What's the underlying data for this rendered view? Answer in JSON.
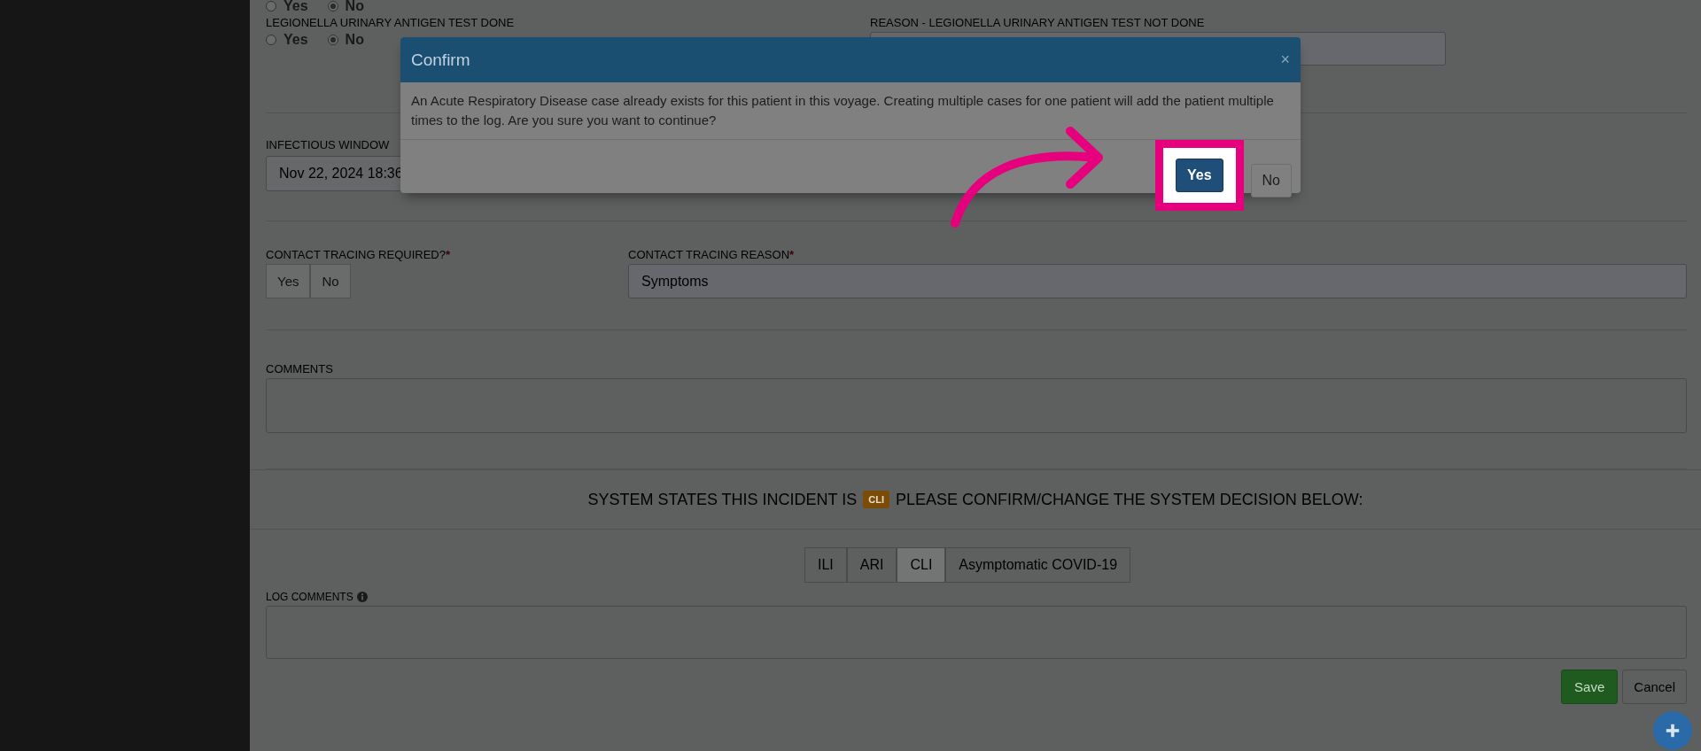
{
  "top_radio": {
    "options": [
      {
        "label": "Yes",
        "selected": false
      },
      {
        "label": "No",
        "selected": true
      }
    ]
  },
  "legionella": {
    "label": "LEGIONELLA URINARY ANTIGEN TEST DONE",
    "options": [
      {
        "label": "Yes",
        "selected": false
      },
      {
        "label": "No",
        "selected": true
      }
    ]
  },
  "legionella_reason": {
    "label": "REASON - LEGIONELLA URINARY ANTIGEN TEST NOT DONE"
  },
  "infectious_window": {
    "label": "INFECTIOUS WINDOW",
    "value": "Nov 22, 2024 18:36"
  },
  "contact_tracing_required": {
    "label": "CONTACT TRACING REQUIRED?",
    "required_mark": "*",
    "options": [
      {
        "label": "Yes",
        "selected": false
      },
      {
        "label": "No",
        "selected": false
      }
    ]
  },
  "contact_tracing_reason": {
    "label": "CONTACT TRACING REASON",
    "required_mark": "*",
    "value": "Symptoms"
  },
  "comments": {
    "label": "COMMENTS"
  },
  "system_banner": {
    "text_before": "SYSTEM STATES THIS INCIDENT IS",
    "badge": "CLI",
    "text_after": "PLEASE CONFIRM/CHANGE THE SYSTEM DECISION BELOW:"
  },
  "classification": [
    {
      "label": "ILI",
      "selected": false
    },
    {
      "label": "ARI",
      "selected": false
    },
    {
      "label": "CLI",
      "selected": true
    },
    {
      "label": "Asymptomatic COVID-19",
      "selected": false
    }
  ],
  "log_comments": {
    "label": "LOG COMMENTS"
  },
  "actions": {
    "save": "Save",
    "cancel": "Cancel"
  },
  "modal": {
    "title": "Confirm",
    "close": "×",
    "message": "An Acute Respiratory Disease case already exists for this patient in this voyage. Creating multiple cases for one patient will add the patient multiple times to the log. Are you sure you want to continue?",
    "buttons": [
      {
        "label": "Yes",
        "highlighted": true
      },
      {
        "label": "No",
        "highlighted": false
      }
    ]
  }
}
